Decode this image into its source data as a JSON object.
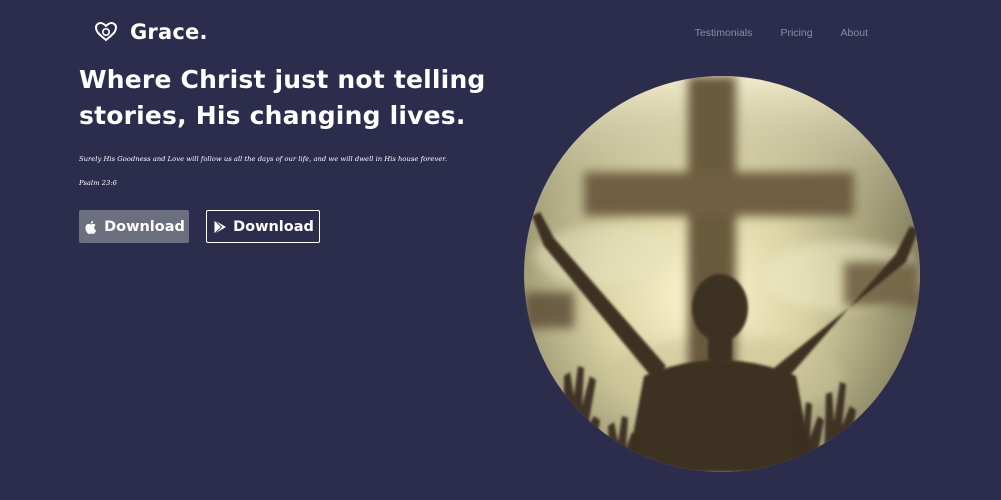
{
  "brand": {
    "name": "Grace.",
    "icon": "heart-logo-icon"
  },
  "nav": {
    "items": [
      "Testimonials",
      "Pricing",
      "About"
    ]
  },
  "hero": {
    "headline": "Where Christ just not telling stories, His changing lives.",
    "verse": "Surely His Goodness and Love will follow us all the days of our life, and we will dwell in His house forever.",
    "verse_ref": "Psalm 23:6",
    "buttons": [
      {
        "label": "Download",
        "icon": "apple-icon"
      },
      {
        "label": "Download",
        "icon": "play-store-icon"
      }
    ],
    "image": {
      "icon": "worship-cross-image"
    }
  },
  "colors": {
    "background": "#2c2d4d",
    "nav_text": "#8a8ca6",
    "apple_button": "#6c6f7f",
    "text": "#ffffff"
  }
}
